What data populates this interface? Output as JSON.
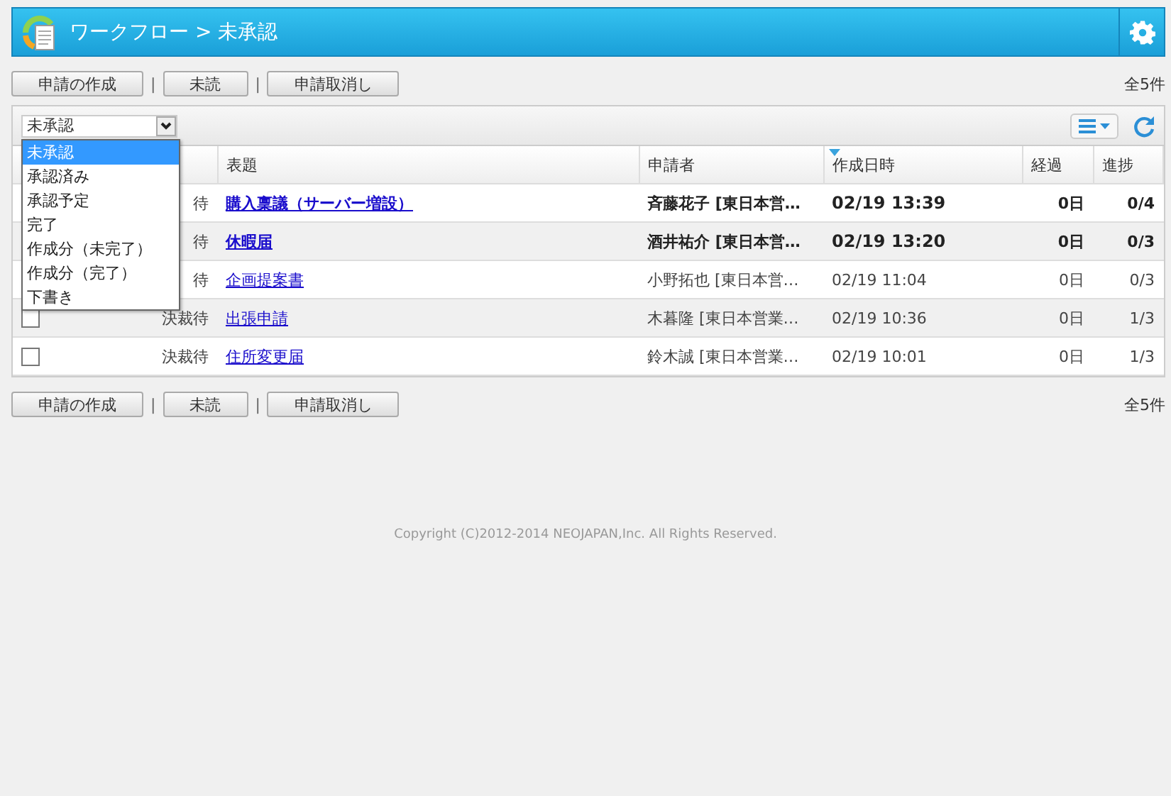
{
  "header": {
    "breadcrumb": "ワークフロー > 未承認"
  },
  "top_actions": [
    {
      "kind": "button",
      "label": "申請の作成"
    },
    {
      "kind": "separator",
      "label": "|"
    },
    {
      "kind": "button",
      "label": "未読"
    },
    {
      "kind": "separator",
      "label": "|"
    },
    {
      "kind": "button",
      "label": "申請取消し"
    }
  ],
  "top_total": "全5件",
  "filter": {
    "value": "未承認",
    "expanded": true,
    "options": [
      {
        "label": "未承認",
        "selected": true
      },
      {
        "label": "承認済み",
        "selected": false
      },
      {
        "label": "承認予定",
        "selected": false
      },
      {
        "label": "完了",
        "selected": false
      },
      {
        "label": "作成分（未完了）",
        "selected": false
      },
      {
        "label": "作成分（完了）",
        "selected": false
      },
      {
        "label": "下書き",
        "selected": false
      }
    ]
  },
  "table": {
    "columns": [
      {
        "label": "表題",
        "sorted": false
      },
      {
        "label": "申請者",
        "sorted": false
      },
      {
        "label": "作成日時",
        "sorted": true
      },
      {
        "label": "経過",
        "sorted": false
      },
      {
        "label": "進捗",
        "sorted": false
      }
    ],
    "rows": [
      {
        "status": "待",
        "title": "購入稟議（サーバー増設）",
        "applicant": "斉藤花子 [東日本営…",
        "created": "02/19 13:39",
        "elapsed": "0日",
        "progress": "0/4",
        "unread": true
      },
      {
        "status": "待",
        "title": "休暇届",
        "applicant": "酒井祐介 [東日本営…",
        "created": "02/19 13:20",
        "elapsed": "0日",
        "progress": "0/3",
        "unread": true
      },
      {
        "status": "待",
        "title": "企画提案書",
        "applicant": "小野拓也 [東日本営…",
        "created": "02/19 11:04",
        "elapsed": "0日",
        "progress": "0/3",
        "unread": false
      },
      {
        "checked": false,
        "status": "決裁待",
        "title": "出張申請",
        "applicant": "木暮隆 [東日本営業…",
        "created": "02/19 10:36",
        "elapsed": "0日",
        "progress": "1/3",
        "unread": false
      },
      {
        "checked": false,
        "status": "決裁待",
        "title": "住所変更届",
        "applicant": "鈴木誠 [東日本営業…",
        "created": "02/19 10:01",
        "elapsed": "0日",
        "progress": "1/3",
        "unread": false
      }
    ]
  },
  "bottom_actions": [
    {
      "kind": "button",
      "label": "申請の作成"
    },
    {
      "kind": "separator",
      "label": "|"
    },
    {
      "kind": "button",
      "label": "未読"
    },
    {
      "kind": "separator",
      "label": "|"
    },
    {
      "kind": "button",
      "label": "申請取消し"
    }
  ],
  "bottom_total": "全5件",
  "footer": "Copyright (C)2012-2014 NEOJAPAN,Inc. All Rights Reserved."
}
